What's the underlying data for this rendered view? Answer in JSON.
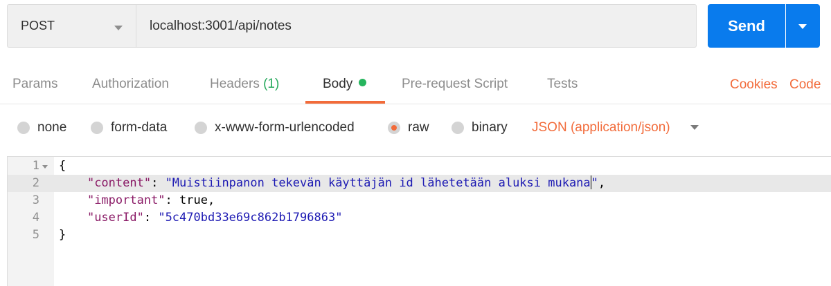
{
  "request": {
    "method": "POST",
    "url": "localhost:3001/api/notes",
    "send_label": "Send"
  },
  "tabs": [
    {
      "label": "Params"
    },
    {
      "label": "Authorization"
    },
    {
      "label": "Headers",
      "count": "(1)"
    },
    {
      "label": "Body",
      "active": true
    },
    {
      "label": "Pre-request Script"
    },
    {
      "label": "Tests"
    }
  ],
  "links": {
    "cookies": "Cookies",
    "code": "Code"
  },
  "body_types": [
    {
      "label": "none",
      "checked": false
    },
    {
      "label": "form-data",
      "checked": false
    },
    {
      "label": "x-www-form-urlencoded",
      "checked": false
    },
    {
      "label": "raw",
      "checked": true
    },
    {
      "label": "binary",
      "checked": false
    }
  ],
  "format_label": "JSON (application/json)",
  "editor": {
    "highlighted_line": 2,
    "lines": [
      {
        "num": "1",
        "open": "{"
      },
      {
        "num": "2",
        "key": "\"content\"",
        "sep": ": ",
        "value": "\"Muistiinpanon tekevän käyttäjän id lähetetään aluksi mukana",
        "value_end": "\"",
        "tail": ","
      },
      {
        "num": "3",
        "key": "\"important\"",
        "sep": ": ",
        "value": "true",
        "tail": ","
      },
      {
        "num": "4",
        "key": "\"userId\"",
        "sep": ": ",
        "value": "\"5c470bd33e69c862b1796863\""
      },
      {
        "num": "5",
        "open": "}"
      }
    ]
  },
  "colors": {
    "accent": "#f26b3a",
    "send_button": "#097bed",
    "status_dot": "#26b55e",
    "json_key": "#8a1a66",
    "json_string": "#1d1ab3"
  }
}
